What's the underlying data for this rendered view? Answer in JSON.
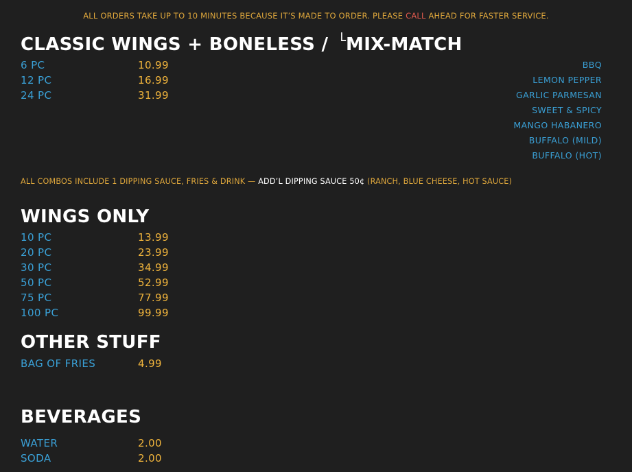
{
  "notice": {
    "prefix": "ALL ORDERS TAKE UP TO 10 MINUTES BECAUSE IT’S MADE TO ORDER. PLEASE ",
    "call": "CALL",
    "suffix": " AHEAD FOR FASTER SERVICE."
  },
  "classic": {
    "title": "CLASSIC WINGS + BONELESS / ",
    "corner_glyph": "└",
    "title_tail": "MIX-MATCH",
    "items": [
      {
        "label": "6 PC",
        "price": "10.99"
      },
      {
        "label": "12 PC",
        "price": "16.99"
      },
      {
        "label": "24 PC",
        "price": "31.99"
      }
    ],
    "flavors": [
      "BBQ",
      "LEMON PEPPER",
      "GARLIC PARMESAN",
      "SWEET & SPICY",
      "MANGO HABANERO",
      "BUFFALO (MILD)",
      "BUFFALO (HOT)"
    ]
  },
  "combo": {
    "part1": "ALL COMBOS INCLUDE 1 DIPPING SAUCE, FRIES & DRINK — ",
    "part2": "ADD’L DIPPING SAUCE 50¢",
    "part3": " (RANCH, BLUE CHEESE, HOT SAUCE)"
  },
  "wings_only": {
    "title": "WINGS ONLY",
    "items": [
      {
        "label": "10 PC",
        "price": "13.99"
      },
      {
        "label": "20 PC",
        "price": "23.99"
      },
      {
        "label": "30 PC",
        "price": "34.99"
      },
      {
        "label": "50 PC",
        "price": "52.99"
      },
      {
        "label": "75 PC",
        "price": "77.99"
      },
      {
        "label": "100 PC",
        "price": "99.99"
      }
    ]
  },
  "other": {
    "title": "OTHER STUFF",
    "items": [
      {
        "label": "BAG OF FRIES",
        "price": "4.99"
      }
    ]
  },
  "beverages": {
    "title": "BEVERAGES",
    "items": [
      {
        "label": "WATER",
        "price": "2.00"
      },
      {
        "label": "SODA",
        "price": "2.00"
      }
    ]
  },
  "colors": {
    "background": "#1f1f1f",
    "item_blue": "#3aa0d6",
    "price_gold": "#f0b43c",
    "call_red": "#e05a4e"
  }
}
